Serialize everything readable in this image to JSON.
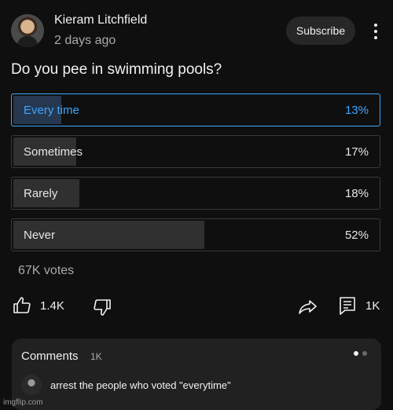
{
  "post": {
    "channel_name": "Kieram Litchfield",
    "time": "2 days ago",
    "subscribe_label": "Subscribe",
    "more_icon": "more-vertical-icon"
  },
  "poll": {
    "question": "Do you pee in swimming pools?",
    "options": [
      {
        "label": "Every time",
        "percent": "13%",
        "fraction": 0.13,
        "selected": true
      },
      {
        "label": "Sometimes",
        "percent": "17%",
        "fraction": 0.17,
        "selected": false
      },
      {
        "label": "Rarely",
        "percent": "18%",
        "fraction": 0.18,
        "selected": false
      },
      {
        "label": "Never",
        "percent": "52%",
        "fraction": 0.52,
        "selected": false
      }
    ],
    "votes": "67K votes"
  },
  "actions": {
    "like_count": "1.4K",
    "comment_count": "1K",
    "icons": [
      "thumbs-up-icon",
      "thumbs-down-icon",
      "share-icon",
      "comment-icon"
    ]
  },
  "comments": {
    "title": "Comments",
    "count": "1K",
    "preview_text": "arrest the people who voted \"everytime\""
  },
  "watermark": "imgflip.com",
  "colors": {
    "background": "#0f0f0f",
    "accent": "#3ea6ff",
    "panel": "#212121"
  }
}
